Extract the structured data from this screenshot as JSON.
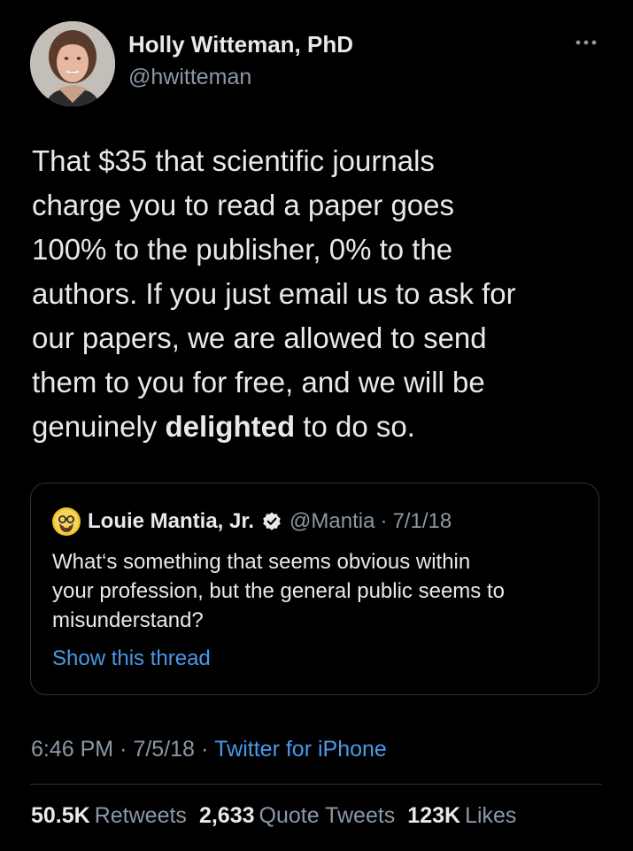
{
  "author": {
    "name": "Holly Witteman, PhD",
    "handle": "@hwitteman"
  },
  "tweet": {
    "lines": [
      "That $35 that scientific journals",
      "charge you to read a paper goes",
      "100% to the publisher, 0% to the",
      "authors. If you just email us to ask for",
      "our papers, we are allowed to send",
      "them to you for free, and we will be"
    ],
    "last_line_before": "genuinely ",
    "last_line_bold": "delighted",
    "last_line_after": " to do so."
  },
  "quoted_tweet": {
    "name": "Louie Mantia, Jr.",
    "handle": "@Mantia",
    "separator": "·",
    "date": "7/1/18",
    "lines": [
      "What‘s something that seems obvious within",
      "your profession, but the general public seems to",
      "misunderstand?"
    ],
    "show_thread_label": "Show this thread"
  },
  "meta": {
    "time": "6:46 PM",
    "separator": "·",
    "date": "7/5/18",
    "source": "Twitter for iPhone"
  },
  "stats": [
    {
      "value": "50.5K",
      "label": "Retweets"
    },
    {
      "value": "2,633",
      "label": "Quote Tweets"
    },
    {
      "value": "123K",
      "label": "Likes"
    }
  ],
  "icons": {
    "more": "more-horizontal-icon",
    "verified": "verified-badge-icon"
  },
  "colors": {
    "background": "#000000",
    "primary_text": "#e7e9ea",
    "secondary_text": "#8b98a5",
    "link": "#4a99e9",
    "border": "#2f3336"
  }
}
